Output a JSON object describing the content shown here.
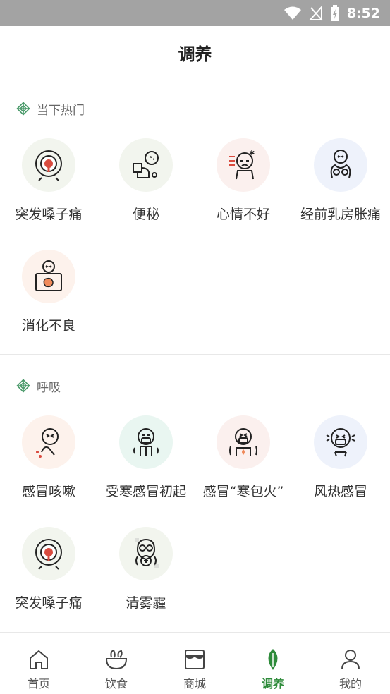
{
  "status_bar": {
    "time": "8:52"
  },
  "header": {
    "title": "调养"
  },
  "sections": [
    {
      "title": "当下热门",
      "items": [
        {
          "label": "突发嗓子痛",
          "icon": "sore-throat-icon",
          "bg": "#f2f5ee"
        },
        {
          "label": "便秘",
          "icon": "constipation-icon",
          "bg": "#f2f5ee"
        },
        {
          "label": "心情不好",
          "icon": "bad-mood-icon",
          "bg": "#fbf0ee"
        },
        {
          "label": "经前乳房胀痛",
          "icon": "breast-pain-icon",
          "bg": "#eef2fb"
        },
        {
          "label": "消化不良",
          "icon": "indigestion-icon",
          "bg": "#fdf2ec"
        }
      ]
    },
    {
      "title": "呼吸",
      "items": [
        {
          "label": "感冒咳嗽",
          "icon": "cough-icon",
          "bg": "#fdf2ec"
        },
        {
          "label": "受寒感冒初起",
          "icon": "cold-onset-icon",
          "bg": "#e9f6f1"
        },
        {
          "label": "感冒“寒包火”",
          "icon": "cold-fire-icon",
          "bg": "#fbf0ee"
        },
        {
          "label": "风热感冒",
          "icon": "wind-heat-cold-icon",
          "bg": "#eef2fb"
        },
        {
          "label": "突发嗓子痛",
          "icon": "sore-throat-icon",
          "bg": "#f2f5ee"
        },
        {
          "label": "清雾霾",
          "icon": "gas-mask-icon",
          "bg": "#f2f5ee"
        }
      ]
    }
  ],
  "tabs": [
    {
      "label": "首页",
      "icon": "home-icon",
      "active": false
    },
    {
      "label": "饮食",
      "icon": "bowl-icon",
      "active": false
    },
    {
      "label": "商城",
      "icon": "shop-icon",
      "active": false
    },
    {
      "label": "调养",
      "icon": "leaf-icon",
      "active": true
    },
    {
      "label": "我的",
      "icon": "user-icon",
      "active": false
    }
  ],
  "colors": {
    "accent": "#2e8b3a",
    "status_bar": "#a3a3a3",
    "icon_red": "#d94b3f"
  }
}
